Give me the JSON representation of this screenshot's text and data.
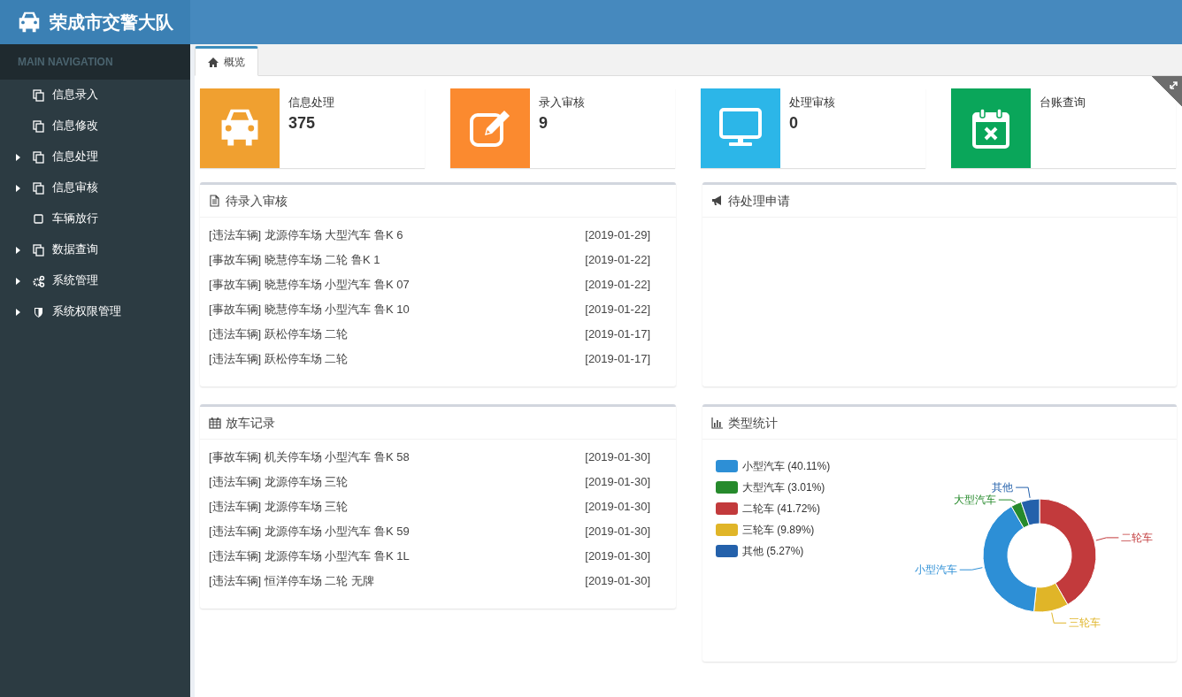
{
  "header": {
    "title": "荣成市交警大队"
  },
  "sidebar": {
    "heading": "MAIN NAVIGATION",
    "items": [
      {
        "label": "信息录入",
        "expandable": false
      },
      {
        "label": "信息修改",
        "expandable": false
      },
      {
        "label": "信息处理",
        "expandable": true
      },
      {
        "label": "信息审核",
        "expandable": true
      },
      {
        "label": "车辆放行",
        "expandable": false
      },
      {
        "label": "数据查询",
        "expandable": true
      },
      {
        "label": "系统管理",
        "expandable": true
      },
      {
        "label": "系统权限管理",
        "expandable": true
      }
    ]
  },
  "tabs": [
    {
      "label": "概览",
      "selected": true
    }
  ],
  "stats": [
    {
      "label": "信息处理",
      "value": "375",
      "color": "#f0a030"
    },
    {
      "label": "录入审核",
      "value": "9",
      "color": "#fb8a2f"
    },
    {
      "label": "处理审核",
      "value": "0",
      "color": "#2cb6e8"
    },
    {
      "label": "台账查询",
      "color": "#0aa65a"
    }
  ],
  "panels": [
    {
      "title": "待录入审核",
      "rows": [
        {
          "text": "[违法车辆] 龙源停车场 大型汽车 鲁K 6",
          "date": "[2019-01-29]"
        },
        {
          "text": "[事故车辆] 晓慧停车场 二轮 鲁K 1",
          "date": "[2019-01-22]"
        },
        {
          "text": "[事故车辆] 晓慧停车场 小型汽车 鲁K 07",
          "date": "[2019-01-22]"
        },
        {
          "text": "[事故车辆] 晓慧停车场 小型汽车 鲁K 10",
          "date": "[2019-01-22]"
        },
        {
          "text": "[违法车辆] 跃松停车场 二轮",
          "date": "[2019-01-17]"
        },
        {
          "text": "[违法车辆] 跃松停车场 二轮",
          "date": "[2019-01-17]"
        }
      ]
    },
    {
      "title": "待处理申请"
    },
    {
      "title": "放车记录",
      "rows": [
        {
          "text": "[事故车辆] 机关停车场 小型汽车 鲁K 58",
          "date": "[2019-01-30]"
        },
        {
          "text": "[违法车辆] 龙源停车场 三轮",
          "date": "[2019-01-30]"
        },
        {
          "text": "[违法车辆] 龙源停车场 三轮",
          "date": "[2019-01-30]"
        },
        {
          "text": "[违法车辆] 龙源停车场 小型汽车 鲁K 59",
          "date": "[2019-01-30]"
        },
        {
          "text": "[违法车辆] 龙源停车场 小型汽车 鲁K 1L",
          "date": "[2019-01-30]"
        },
        {
          "text": "[违法车辆] 恒洋停车场 二轮 无牌",
          "date": "[2019-01-30]"
        }
      ]
    },
    {
      "title": "类型统计",
      "legend": [
        {
          "label": "小型汽车 (40.11%)",
          "color": "#2d8fd6"
        },
        {
          "label": "大型汽车 (3.01%)",
          "color": "#268a2c"
        },
        {
          "label": "二轮车 (41.72%)",
          "color": "#c23a3c"
        },
        {
          "label": "三轮车 (9.89%)",
          "color": "#e0b528"
        },
        {
          "label": "其他 (5.27%)",
          "color": "#2461ab"
        }
      ],
      "chart_data": {
        "type": "donut",
        "categories": [
          "二轮车",
          "三轮车",
          "小型汽车",
          "大型汽车",
          "其他"
        ],
        "values": [
          41.72,
          9.89,
          40.11,
          3.01,
          5.27
        ],
        "colors": [
          "#c23a3c",
          "#e0b528",
          "#2d8fd6",
          "#268a2c",
          "#2461ab"
        ]
      }
    }
  ]
}
